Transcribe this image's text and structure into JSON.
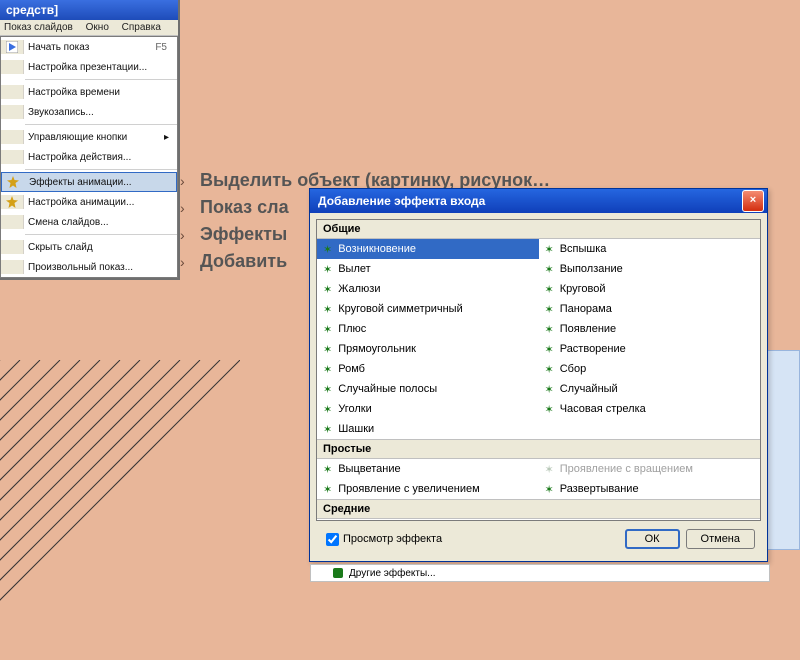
{
  "menu": {
    "title": "средств]",
    "menubar": [
      "Показ слайдов",
      "Окно",
      "Справка"
    ],
    "items": [
      {
        "icon": "play",
        "label": "Начать показ",
        "shortcut": "F5"
      },
      {
        "icon": "",
        "label": "Настройка презентации..."
      },
      {
        "sep": true
      },
      {
        "icon": "",
        "label": "Настройка времени"
      },
      {
        "icon": "",
        "label": "Звукозапись..."
      },
      {
        "sep": true
      },
      {
        "icon": "",
        "label": "Управляющие кнопки",
        "sub": true
      },
      {
        "icon": "",
        "label": "Настройка действия..."
      },
      {
        "sep": true
      },
      {
        "icon": "star",
        "label": "Эффекты анимации...",
        "highlight": true
      },
      {
        "icon": "star2",
        "label": "Настройка анимации..."
      },
      {
        "icon": "",
        "label": "Смена слайдов..."
      },
      {
        "sep": true
      },
      {
        "icon": "",
        "label": "Скрыть слайд"
      },
      {
        "icon": "",
        "label": "Произвольный показ..."
      }
    ]
  },
  "bullets": [
    "Выделить объект (картинку, рисунок…",
    "Показ сла",
    "Эффекты",
    "Добавить"
  ],
  "dialog": {
    "title": "Добавление эффекта входа",
    "sections": [
      {
        "header": "Общие",
        "effects": [
          {
            "label": "Возникновение",
            "selected": true
          },
          {
            "label": "Вспышка"
          },
          {
            "label": "Вылет"
          },
          {
            "label": "Выползание"
          },
          {
            "label": "Жалюзи"
          },
          {
            "label": "Круговой"
          },
          {
            "label": "Круговой симметричный"
          },
          {
            "label": "Панорама"
          },
          {
            "label": "Плюс"
          },
          {
            "label": "Появление"
          },
          {
            "label": "Прямоугольник"
          },
          {
            "label": "Растворение"
          },
          {
            "label": "Ромб"
          },
          {
            "label": "Сбор"
          },
          {
            "label": "Случайные полосы"
          },
          {
            "label": "Случайный"
          },
          {
            "label": "Уголки"
          },
          {
            "label": "Часовая стрелка"
          },
          {
            "label": "Шашки"
          },
          {
            "label": ""
          }
        ]
      },
      {
        "header": "Простые",
        "effects": [
          {
            "label": "Выцветание"
          },
          {
            "label": "Проявление с вращением",
            "disabled": true
          },
          {
            "label": "Проявление с увеличением"
          },
          {
            "label": "Развертывание"
          }
        ]
      },
      {
        "header": "Средние",
        "effects": []
      }
    ],
    "preview_label": "Просмотр эффекта",
    "ok_label": "ОК",
    "cancel_label": "Отмена"
  },
  "bottom_bar": "Другие эффекты..."
}
